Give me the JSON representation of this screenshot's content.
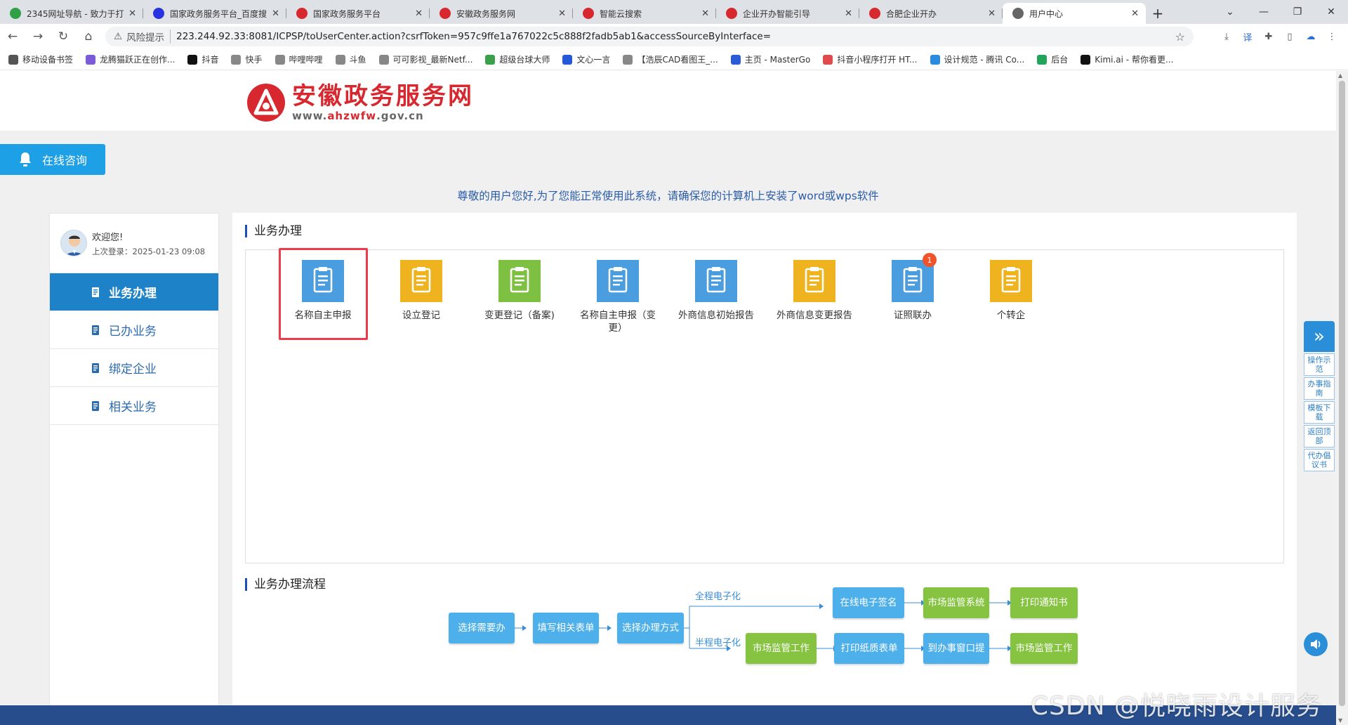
{
  "browser": {
    "tabs": [
      {
        "title": "2345网址导航 - 致力于打",
        "color": "#2fa045"
      },
      {
        "title": "国家政务服务平台_百度搜",
        "color": "#2932e1"
      },
      {
        "title": "国家政务服务平台",
        "color": "#d7282f"
      },
      {
        "title": "安徽政务服务网",
        "color": "#d7282f"
      },
      {
        "title": "智能云搜索",
        "color": "#d7282f"
      },
      {
        "title": "企业开办智能引导",
        "color": "#d7282f"
      },
      {
        "title": "合肥企业开办",
        "color": "#d7282f"
      },
      {
        "title": "用户中心",
        "color": "#666666"
      }
    ],
    "risk_label": "风险提示",
    "url": "223.244.92.33:8081/ICPSP/toUserCenter.action?csrfToken=957c9ffe1a767022c5c888f2fadb5ab1&accessSourceByInterface=",
    "bookmarks": [
      {
        "label": "移动设备书签",
        "color": "#555555"
      },
      {
        "label": "龙腾猫跃正在创作...",
        "color": "#7b5cd6"
      },
      {
        "label": "抖音",
        "color": "#111111"
      },
      {
        "label": "快手",
        "color": "#888888"
      },
      {
        "label": "哔哩哔哩",
        "color": "#888888"
      },
      {
        "label": "斗鱼",
        "color": "#888888"
      },
      {
        "label": "可可影视_最新Netf...",
        "color": "#888888"
      },
      {
        "label": "超级台球大师",
        "color": "#3aa04a"
      },
      {
        "label": "文心一言",
        "color": "#2458d8"
      },
      {
        "label": "【浩辰CAD看图王_...",
        "color": "#888888"
      },
      {
        "label": "主页 - MasterGo",
        "color": "#2b5bd7"
      },
      {
        "label": "抖音小程序打开 HT...",
        "color": "#e04a4a"
      },
      {
        "label": "设计规范 - 腾讯 Co...",
        "color": "#2b8be0"
      },
      {
        "label": "后台",
        "color": "#22a55a"
      },
      {
        "label": "Kimi.ai - 帮你看更...",
        "color": "#111111"
      }
    ]
  },
  "site": {
    "logo_title": "安徽政务服务网",
    "logo_domain_prefix": "www.",
    "logo_domain_main": "ahzwfw",
    "logo_domain_suffix": ".gov.cn",
    "consult_label": "在线咨询",
    "notice": "尊敬的用户您好,为了您能正常使用此系统，请确保您的计算机上安装了word或wps软件"
  },
  "user": {
    "welcome": "欢迎您!",
    "last_login": "上次登录：2025-01-23 09:08"
  },
  "menu": [
    {
      "label": "业务办理",
      "active": true
    },
    {
      "label": "已办业务",
      "active": false
    },
    {
      "label": "绑定企业",
      "active": false
    },
    {
      "label": "相关业务",
      "active": false
    }
  ],
  "section_services": "业务办理",
  "services": [
    {
      "label": "名称自主申报",
      "color": "#4a9ee0"
    },
    {
      "label": "设立登记",
      "color": "#f0b320"
    },
    {
      "label": "变更登记（备案)",
      "color": "#7ec142"
    },
    {
      "label": "名称自主申报（变更）",
      "color": "#4a9ee0"
    },
    {
      "label": "外商信息初始报告",
      "color": "#4a9ee0"
    },
    {
      "label": "外商信息变更报告",
      "color": "#f0b320"
    },
    {
      "label": "证照联办",
      "color": "#4a9ee0",
      "badge": "1"
    },
    {
      "label": "个转企",
      "color": "#f0b320"
    }
  ],
  "section_flow": "业务办理流程",
  "flow": {
    "steps": [
      "选择需要办",
      "填写相关表单",
      "选择办理方式"
    ],
    "branch_full": "全程电子化",
    "branch_half": "半程电子化",
    "full_steps": [
      "在线电子签名",
      "市场监管系统",
      "打印通知书"
    ],
    "half_steps": [
      "市场监管工作",
      "打印纸质表单",
      "到办事窗口提",
      "市场监管工作"
    ]
  },
  "right_tools": [
    "操作示范",
    "办事指南",
    "模板下载",
    "返回顶部",
    "代办倡议书"
  ],
  "watermark": "CSDN @悦晓雨设计服务"
}
